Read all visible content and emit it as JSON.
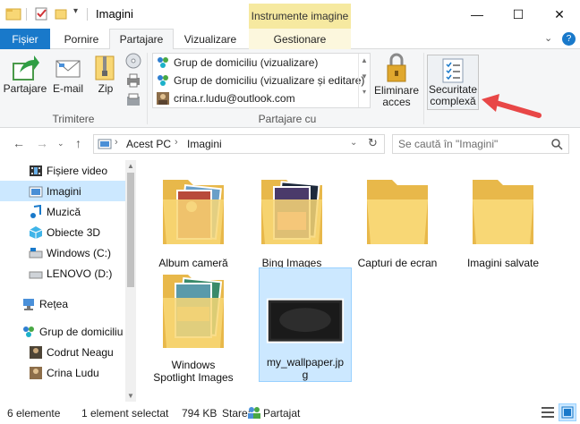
{
  "window": {
    "title": "Imagini",
    "context_tab_header": "Instrumente imagine",
    "min_glyph": "—",
    "max_glyph": "☐",
    "close_glyph": "✕"
  },
  "tabs": [
    {
      "label": "Fișier"
    },
    {
      "label": "Pornire"
    },
    {
      "label": "Partajare"
    },
    {
      "label": "Vizualizare"
    },
    {
      "label": "Gestionare"
    }
  ],
  "ribbon_ctrls": {
    "collapse": "⌄",
    "help": "?"
  },
  "ribbon": {
    "send_group": {
      "label": "Trimitere",
      "share": "Partajare",
      "email": "E-mail",
      "zip": "Zip"
    },
    "share_with_group": {
      "label": "Partajare cu",
      "items": [
        "Grup de domiciliu (vizualizare)",
        "Grup de domiciliu (vizualizare și editare)",
        "crina.r.ludu@outlook.com"
      ],
      "remove_access": [
        "Eliminare",
        "acces"
      ],
      "advanced_security": [
        "Securitate",
        "complexă"
      ]
    }
  },
  "address": {
    "crumbs": [
      "Acest PC",
      "Imagini"
    ],
    "sep": "›",
    "search_placeholder": "Se caută în \"Imagini\""
  },
  "nav": [
    {
      "label": "Fișiere video",
      "icon": "video-folder-icon"
    },
    {
      "label": "Imagini",
      "icon": "pictures-folder-icon",
      "selected": true
    },
    {
      "label": "Muzică",
      "icon": "music-icon"
    },
    {
      "label": "Obiecte 3D",
      "icon": "3d-objects-icon"
    },
    {
      "label": "Windows (C:)",
      "icon": "drive-c-icon"
    },
    {
      "label": "LENOVO (D:)",
      "icon": "drive-d-icon"
    },
    {
      "label": "Rețea",
      "icon": "network-icon"
    },
    {
      "label": "Grup de domiciliu",
      "icon": "homegroup-icon"
    },
    {
      "label": "Codrut Neagu",
      "icon": "user-icon"
    },
    {
      "label": "Crina Ludu",
      "icon": "user-icon"
    }
  ],
  "files": [
    {
      "caption": [
        "Album cameră"
      ],
      "kind": "photos-folder"
    },
    {
      "caption": [
        "Bing Images"
      ],
      "kind": "photos-folder"
    },
    {
      "caption": [
        "Capturi de ecran"
      ],
      "kind": "folder"
    },
    {
      "caption": [
        "Imagini salvate"
      ],
      "kind": "folder"
    },
    {
      "caption": [
        "Windows",
        "Spotlight Images"
      ],
      "kind": "photos-folder"
    },
    {
      "caption": [
        "my_wallpaper.jp",
        "g"
      ],
      "kind": "image",
      "selected": true
    }
  ],
  "status": {
    "count": "6 elemente",
    "selection": "1 element selectat",
    "size": "794 KB",
    "state_label": "Stare:",
    "state_value": "Partajat"
  },
  "colors": {
    "accent": "#1979ca",
    "selection": "#cce8ff",
    "folder": "#f8d775",
    "arrow": "#e84747",
    "context_tab": "#f6e9a0"
  }
}
